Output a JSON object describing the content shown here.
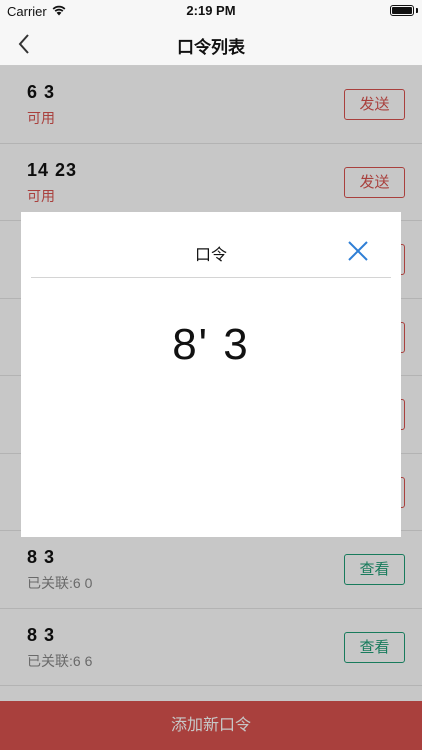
{
  "status": {
    "carrier": "Carrier",
    "time": "2:19 PM",
    "battery_level": 1.0
  },
  "nav": {
    "title": "口令列表",
    "back_icon": "chevron-left-icon"
  },
  "rows": [
    {
      "code": "6      3",
      "sub": "可用",
      "button": "发送"
    },
    {
      "code": "14    23",
      "sub": "可用",
      "button": "发送"
    },
    {
      "code": "",
      "sub": "",
      "button": ""
    },
    {
      "code": "",
      "sub": "",
      "button": ""
    },
    {
      "code": "",
      "sub": "",
      "button": ""
    },
    {
      "code": "",
      "sub": "",
      "button": ""
    },
    {
      "code": "8      3",
      "sub": "已关联:6         0",
      "button": "查看"
    },
    {
      "code": "8      3",
      "sub": "已关联:6        6",
      "button": "查看"
    }
  ],
  "add_button": "添加新口令",
  "dialog": {
    "title": "口令",
    "code": "8'       3",
    "close_icon": "close-icon"
  },
  "colors": {
    "accent_red": "#d9534f",
    "accent_green": "#1f9e76"
  }
}
